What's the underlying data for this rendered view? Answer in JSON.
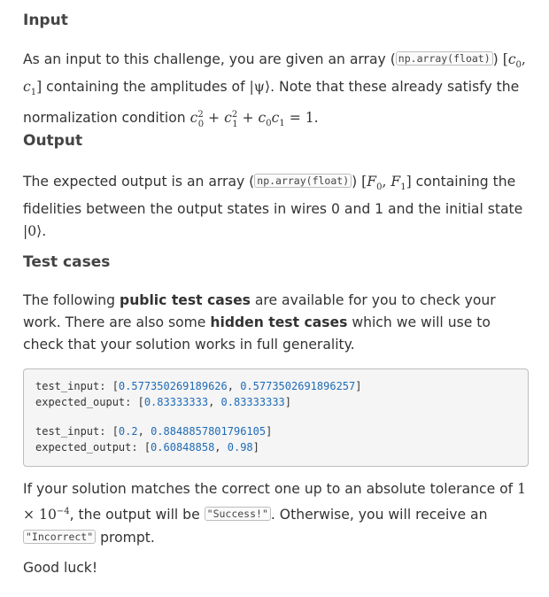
{
  "input": {
    "heading": "Input",
    "t1": "As an input to this challenge, you are given an array (",
    "code": "np.array(float)",
    "t2": ")",
    "c0": "c",
    "c0sub": "0",
    "c1": "c",
    "c1sub": "1",
    "t3": " containing the amplitudes of ",
    "psi": "|ψ⟩",
    "t4": ". Note that these already satisfy the normalization condition ",
    "eq_c0": "c",
    "eq_c0_sup": "2",
    "eq_c0_sub": "0",
    "eq_plus1": " + ",
    "eq_c1": "c",
    "eq_c1_sup": "2",
    "eq_c1_sub": "1",
    "eq_plus2": " + ",
    "eq_c0b": "c",
    "eq_c0b_sub": "0",
    "eq_c1b": "c",
    "eq_c1b_sub": "1",
    "eq_end": " = 1."
  },
  "output": {
    "heading": "Output",
    "t1": "The expected output is an array (",
    "code": "np.array(float)",
    "t2": ") ",
    "F0": "F",
    "F0sub": "0",
    "F1": "F",
    "F1sub": "1",
    "t3": " containing the fidelities between the output states in wires 0 and 1 and the initial state ",
    "ket0": "|0⟩",
    "t4": "."
  },
  "tests": {
    "heading": "Test cases",
    "t1": "The following ",
    "bold1": "public test cases",
    "t2": " are available for you to check your work. There are also some ",
    "bold2": "hidden test cases",
    "t3": " which we will use to check that your solution works in full generality.",
    "lines": [
      {
        "key": "test_input: [",
        "v1": "0.577350269189626",
        "sep": ", ",
        "v2": "0.5773502691896257",
        "end": "]"
      },
      {
        "key": "expected_ouput: [",
        "v1": "0.83333333",
        "sep": ", ",
        "v2": "0.83333333",
        "end": "]"
      },
      {
        "key": "test_input: [",
        "v1": "0.2",
        "sep": ", ",
        "v2": "0.8848857801796105",
        "end": "]"
      },
      {
        "key": "expected_output: [",
        "v1": "0.60848858",
        "sep": ", ",
        "v2": "0.98",
        "end": "]"
      }
    ]
  },
  "tolerance": {
    "t1": "If your solution matches the correct one up to an absolute tolerance of ",
    "num": "1 × 10",
    "exp": "−4",
    "t2": ", the output will be ",
    "success": "\"Success!\"",
    "t3": ". Otherwise, you will receive an ",
    "incorrect": "\"Incorrect\"",
    "t4": " prompt."
  },
  "closing": "Good luck!"
}
